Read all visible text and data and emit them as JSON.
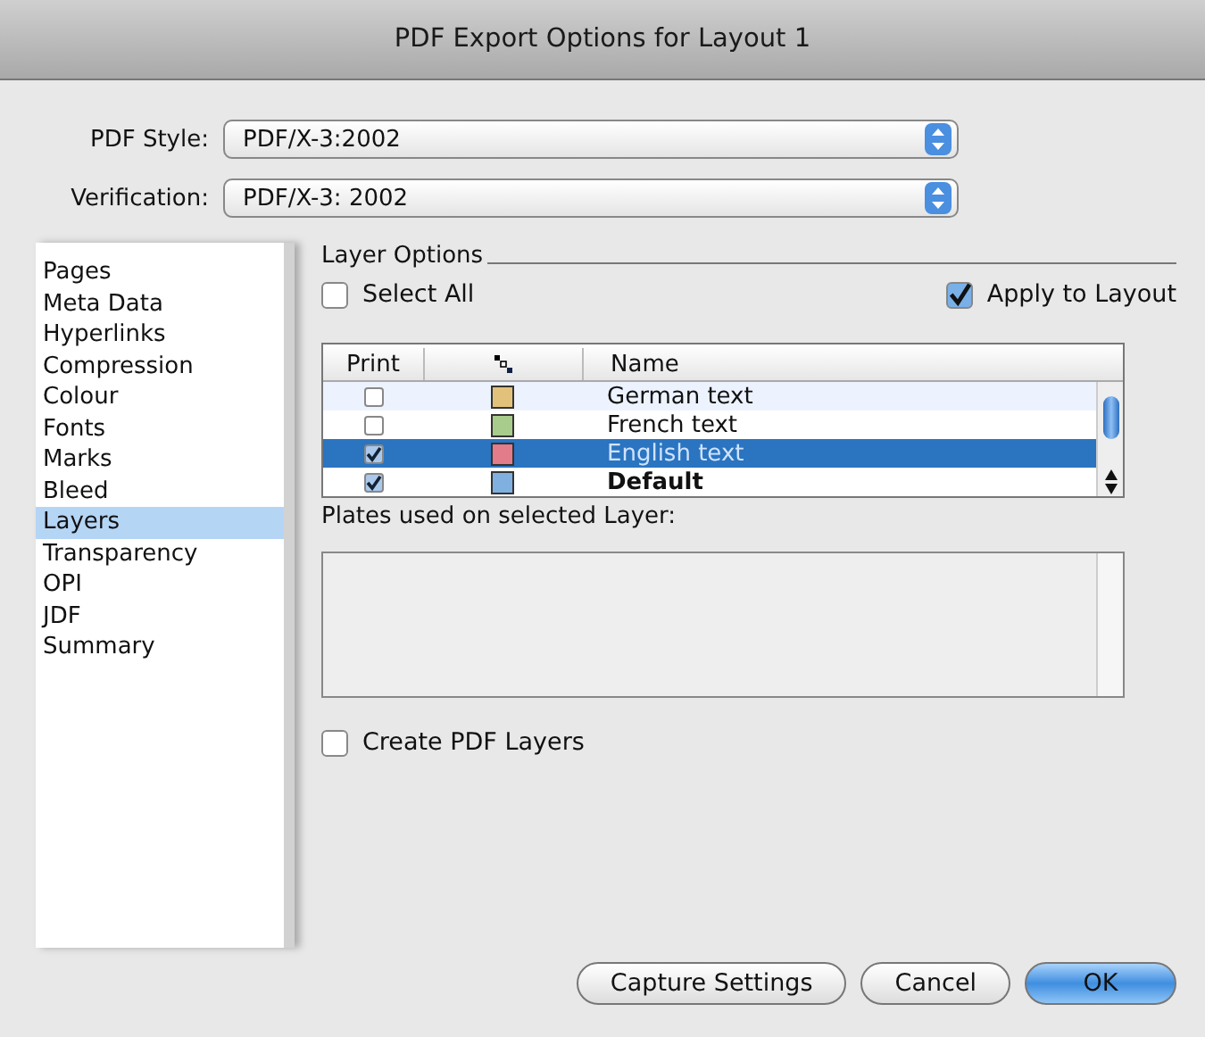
{
  "window": {
    "title": "PDF Export Options for Layout 1"
  },
  "pdf_style": {
    "label": "PDF Style:",
    "value": "PDF/X-3:2002"
  },
  "verification": {
    "label": "Verification:",
    "value": "PDF/X-3: 2002"
  },
  "sidebar": {
    "items": [
      {
        "label": "Pages",
        "selected": false
      },
      {
        "label": "Meta Data",
        "selected": false
      },
      {
        "label": "Hyperlinks",
        "selected": false
      },
      {
        "label": "Compression",
        "selected": false
      },
      {
        "label": "Colour",
        "selected": false
      },
      {
        "label": "Fonts",
        "selected": false
      },
      {
        "label": "Marks",
        "selected": false
      },
      {
        "label": "Bleed",
        "selected": false
      },
      {
        "label": "Layers",
        "selected": true
      },
      {
        "label": "Transparency",
        "selected": false
      },
      {
        "label": "OPI",
        "selected": false
      },
      {
        "label": "JDF",
        "selected": false
      },
      {
        "label": "Summary",
        "selected": false
      }
    ]
  },
  "layer_options": {
    "title": "Layer Options",
    "select_all": {
      "label": "Select All",
      "checked": false
    },
    "apply_to_layout": {
      "label": "Apply to Layout",
      "checked": true
    },
    "table": {
      "columns": [
        "Print",
        "Name"
      ],
      "rows": [
        {
          "print": false,
          "color": "#e2c27a",
          "name": "German text",
          "selected": false,
          "is_default": false
        },
        {
          "print": false,
          "color": "#a8cc8c",
          "name": "French text",
          "selected": false,
          "is_default": false
        },
        {
          "print": true,
          "color": "#e27b8a",
          "name": "English text",
          "selected": true,
          "is_default": false
        },
        {
          "print": true,
          "color": "#7fb0e0",
          "name": "Default",
          "selected": false,
          "is_default": true
        }
      ]
    },
    "plates_label": "Plates used on selected Layer:",
    "create_pdf_layers": {
      "label": "Create PDF Layers",
      "checked": false
    }
  },
  "buttons": [
    {
      "label": "Capture Settings",
      "kind": "normal"
    },
    {
      "label": "Cancel",
      "kind": "normal"
    },
    {
      "label": "OK",
      "kind": "default"
    }
  ]
}
